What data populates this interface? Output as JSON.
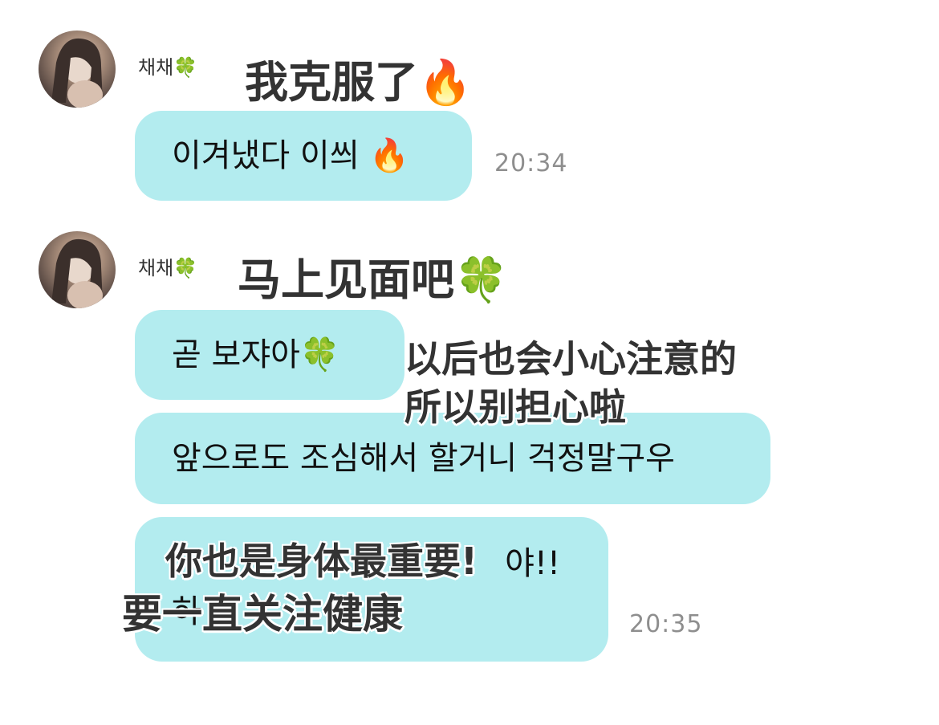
{
  "messages": [
    {
      "sender": "채채",
      "sender_emoji": "🍀",
      "avatar_icon": "profile-photo",
      "bubbles": [
        {
          "text": "이겨냈다 이씌 🔥"
        }
      ],
      "time": "20:34",
      "caption": [
        "我克服了🔥"
      ]
    },
    {
      "sender": "채채",
      "sender_emoji": "🍀",
      "avatar_icon": "profile-photo",
      "bubbles": [
        {
          "text": "곧 보쟈아🍀"
        },
        {
          "text": "앞으로도 조심해서 할거니 걱정말구우"
        },
        {
          "text_line1": "야!!",
          "text_line2": "하"
        }
      ],
      "time": "20:35",
      "captions": {
        "see_soon": "马上见面吧🍀",
        "careful_line1": "以后也会小心注意的",
        "careful_line2": "所以别担心啦",
        "health_line1": "你也是身体最重要!",
        "health_line2": "要一直关注健康"
      }
    }
  ],
  "colors": {
    "bubble": "#b3ecef",
    "timestamp": "#8e8e8e",
    "caption_fill": "#333333",
    "caption_outline": "#ffffff"
  }
}
